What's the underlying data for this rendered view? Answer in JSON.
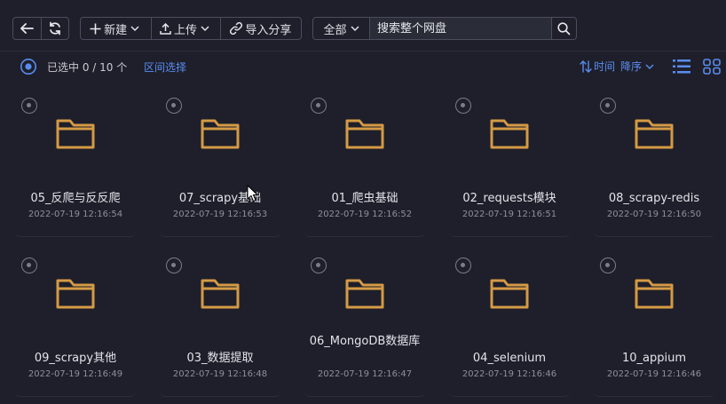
{
  "toolbar": {
    "new_label": "新建",
    "upload_label": "上传",
    "import_label": "导入分享",
    "scope_label": "全部",
    "search_placeholder": "搜索整个网盘"
  },
  "selection": {
    "status": "已选中 0 / 10 个",
    "range_select": "区间选择",
    "sort_field": "时间",
    "sort_order": "降序"
  },
  "colors": {
    "background": "#1e1f2a",
    "accent": "#5a8cf0",
    "folder": "#d49a45"
  },
  "files": [
    {
      "name": "05_反爬与反反爬",
      "time": "2022-07-19 12:16:54"
    },
    {
      "name": "07_scrapy基础",
      "time": "2022-07-19 12:16:53"
    },
    {
      "name": "01_爬虫基础",
      "time": "2022-07-19 12:16:52"
    },
    {
      "name": "02_requests模块",
      "time": "2022-07-19 12:16:51"
    },
    {
      "name": "08_scrapy-redis",
      "time": "2022-07-19 12:16:50"
    },
    {
      "name": "09_scrapy其他",
      "time": "2022-07-19 12:16:49"
    },
    {
      "name": "03_数据提取",
      "time": "2022-07-19 12:16:48"
    },
    {
      "name": "06_MongoDB数据库",
      "time": "2022-07-19 12:16:47"
    },
    {
      "name": "04_selenium",
      "time": "2022-07-19 12:16:46"
    },
    {
      "name": "10_appium",
      "time": "2022-07-19 12:16:46"
    }
  ]
}
